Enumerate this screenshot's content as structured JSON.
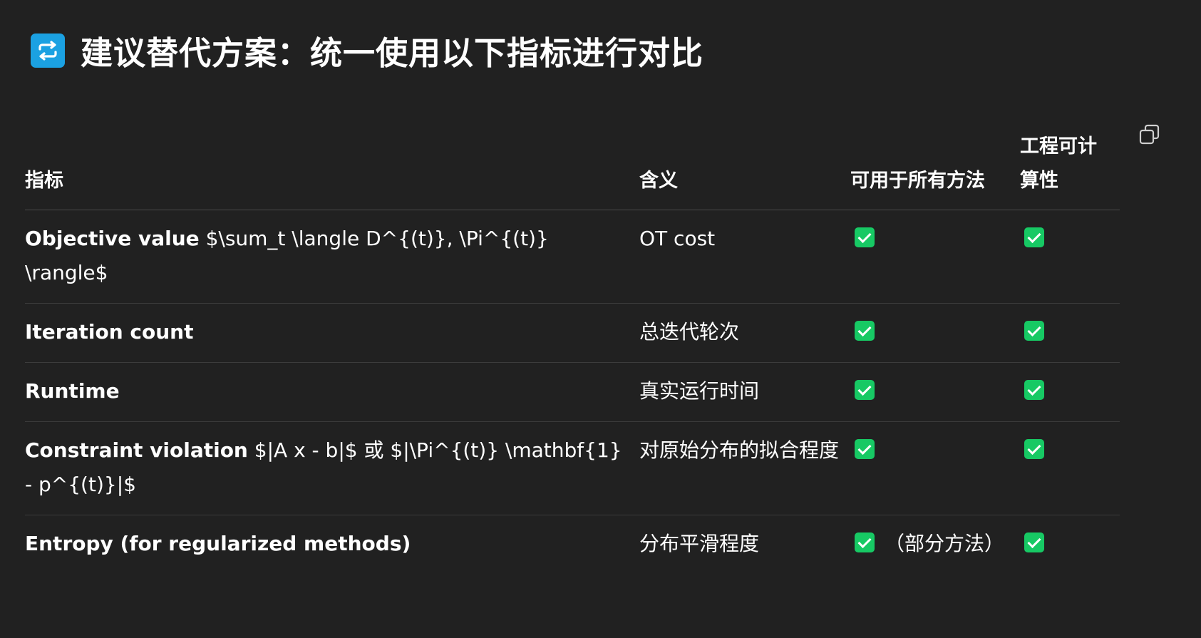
{
  "heading": {
    "icon": "repeat-icon",
    "icon_color": "#1ba1e2",
    "text": "建议替代方案：统一使用以下指标进行对比"
  },
  "copy_icon": "copy-icon",
  "table": {
    "headers": [
      "指标",
      "含义",
      "可用于所有方法",
      "工程可计算性"
    ],
    "rows": [
      {
        "metric": "Objective value",
        "formula": " $\\sum_t \\langle D^{(t)}, \\Pi^{(t)} \\rangle$",
        "meaning": "OT cost",
        "all_methods": "check",
        "all_methods_note": "",
        "computable": "check"
      },
      {
        "metric": "Iteration count",
        "formula": "",
        "meaning": "总迭代轮次",
        "all_methods": "check",
        "all_methods_note": "",
        "computable": "check"
      },
      {
        "metric": "Runtime",
        "formula": "",
        "meaning": "真实运行时间",
        "all_methods": "check",
        "all_methods_note": "",
        "computable": "check"
      },
      {
        "metric": "Constraint violation",
        "formula": " $|A x - b|$ 或 $|\\Pi^{(t)} \\mathbf{1} - p^{(t)}|$",
        "meaning": "对原始分布的拟合程度",
        "all_methods": "check",
        "all_methods_note": "",
        "computable": "check"
      },
      {
        "metric": "Entropy (for regularized methods)",
        "formula": "",
        "meaning": "分布平滑程度",
        "all_methods": "check",
        "all_methods_note": "（部分方法）",
        "computable": "check"
      }
    ]
  },
  "colors": {
    "background": "#212121",
    "check": "#17c964"
  }
}
